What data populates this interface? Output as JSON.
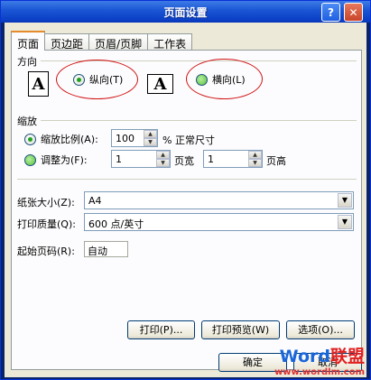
{
  "window": {
    "title": "页面设置",
    "help_button": "?",
    "close_button": "✕"
  },
  "tabs": [
    {
      "label": "页面"
    },
    {
      "label": "页边距"
    },
    {
      "label": "页眉/页脚"
    },
    {
      "label": "工作表"
    }
  ],
  "orientation": {
    "section_label": "方向",
    "portrait_label": "纵向(T)",
    "landscape_label": "横向(L)",
    "page_glyph": "A",
    "selected": "portrait"
  },
  "scaling": {
    "section_label": "缩放",
    "adjust_to_label": "缩放比例(A):",
    "adjust_to_value": "100",
    "adjust_to_unit": "% 正常尺寸",
    "fit_to_label": "调整为(F):",
    "fit_wide_value": "1",
    "fit_wide_unit": "页宽",
    "fit_tall_value": "1",
    "fit_tall_unit": "页高",
    "selected": "adjust_to"
  },
  "paper_size": {
    "label": "纸张大小(Z):",
    "value": "A4"
  },
  "print_quality": {
    "label": "打印质量(Q):",
    "value": "600 点/英寸"
  },
  "first_page_number": {
    "label": "起始页码(R):",
    "value": "自动"
  },
  "buttons": {
    "print": "打印(P)...",
    "print_preview": "打印预览(W)",
    "options": "选项(O)...",
    "ok": "确定",
    "cancel": "取消"
  },
  "watermark": {
    "brand_en": "Word",
    "brand_cn": "联盟",
    "url": "www.wordlm.com"
  },
  "colors": {
    "annotation_ellipse": "#d01010",
    "title_bar": "#0a3ec4",
    "tab_highlight": "#e68b2c"
  }
}
